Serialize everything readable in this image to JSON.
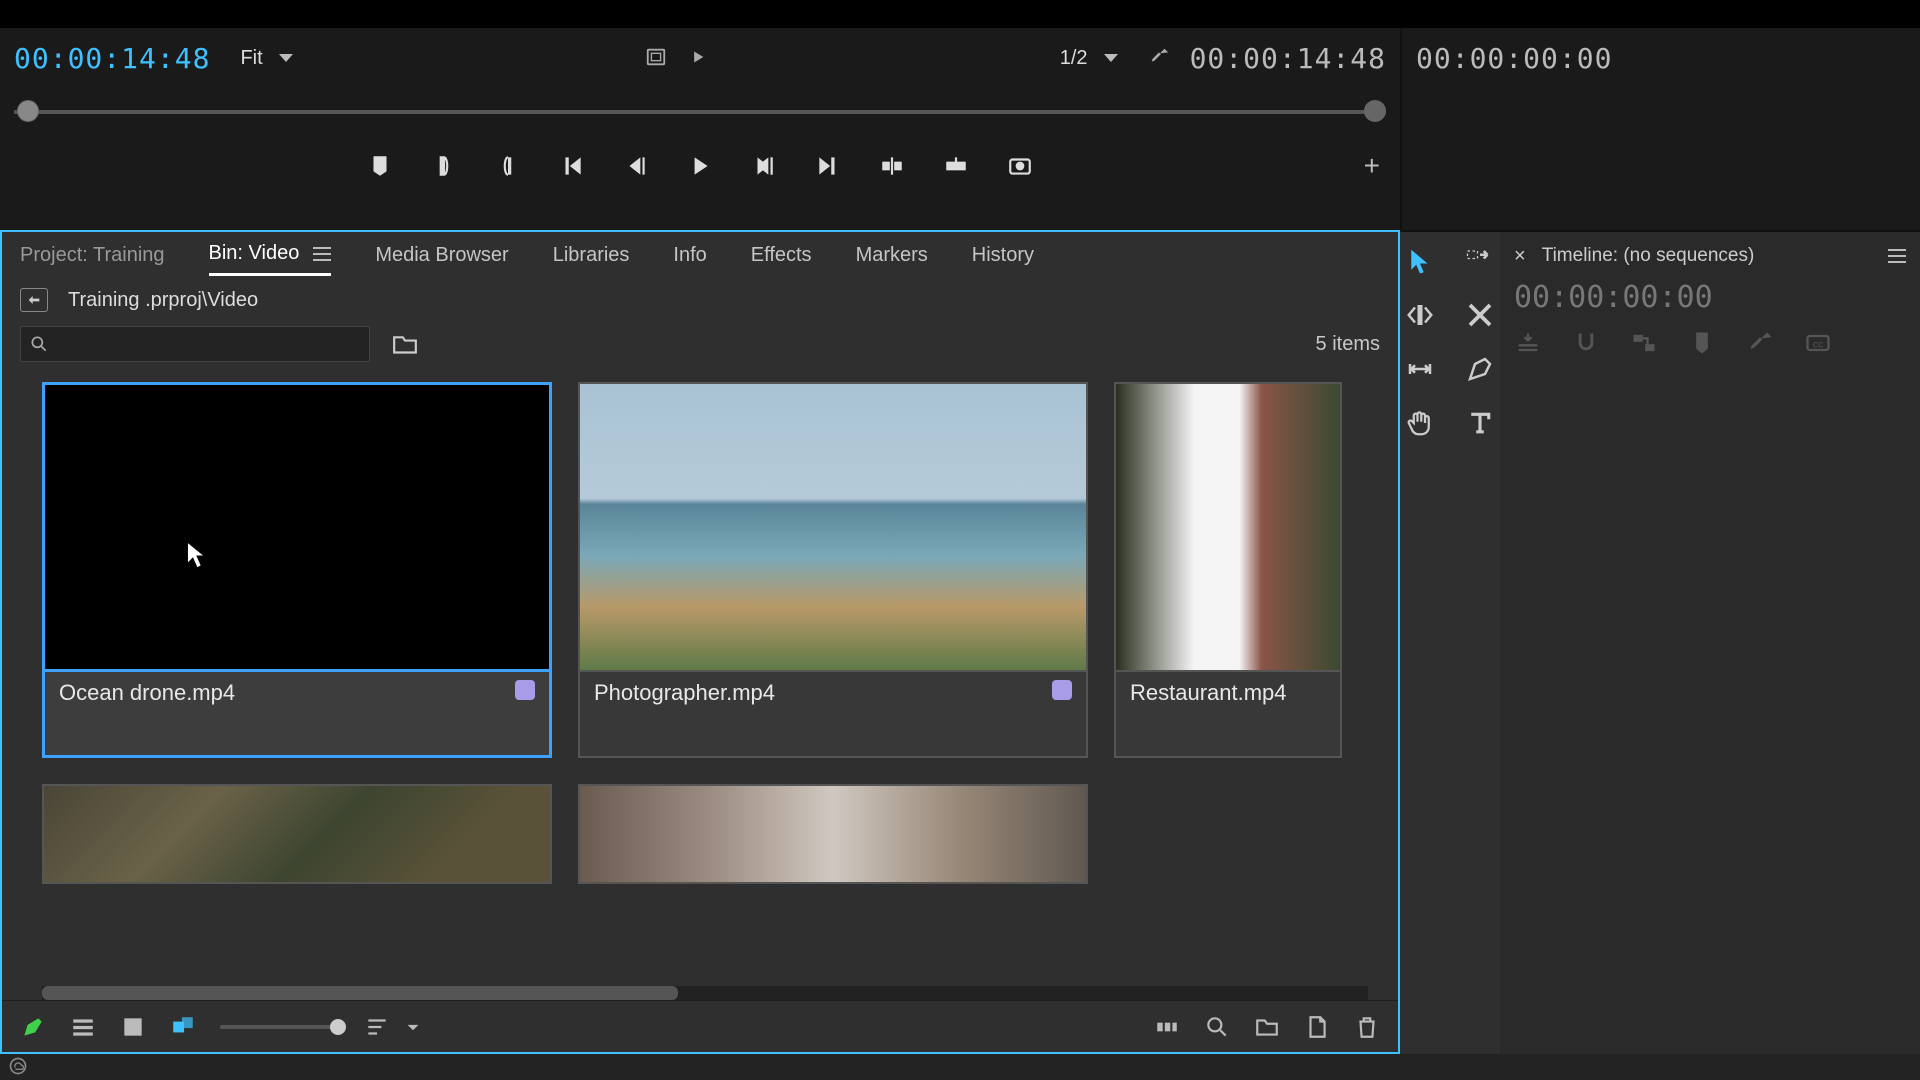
{
  "source_monitor": {
    "timecode_in": "00:00:14:48",
    "fit_label": "Fit",
    "zoom_label": "1/2",
    "timecode_out": "00:00:14:48"
  },
  "program_monitor": {
    "timecode": "00:00:00:00"
  },
  "project": {
    "tabs": {
      "project": "Project: Training",
      "bin": "Bin: Video",
      "media_browser": "Media Browser",
      "libraries": "Libraries",
      "info": "Info",
      "effects": "Effects",
      "markers": "Markers",
      "history": "History"
    },
    "path": "Training .prproj\\Video",
    "item_count": "5 items",
    "clips": [
      {
        "name": "Ocean drone.mp4",
        "selected": true,
        "label": true
      },
      {
        "name": "Photographer.mp4",
        "selected": false,
        "label": true
      },
      {
        "name": "Restaurant.mp4",
        "selected": false,
        "label": false
      }
    ]
  },
  "timeline": {
    "title": "Timeline: (no sequences)",
    "timecode": "00:00:00:00"
  }
}
